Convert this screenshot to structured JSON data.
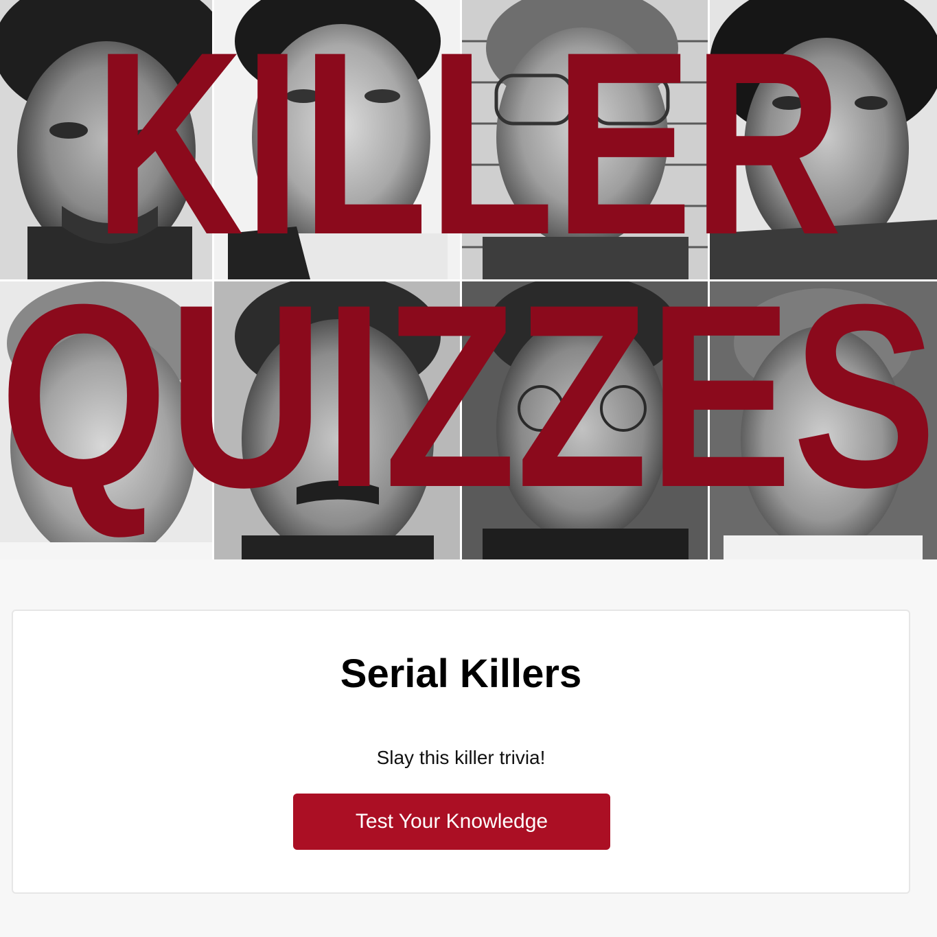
{
  "hero": {
    "title_line_1": "KILLER",
    "title_line_2": "QUIZZES",
    "title_color": "#8b0a1c",
    "photos": [
      {
        "name": "mugshot-photo"
      },
      {
        "name": "mugshot-photo"
      },
      {
        "name": "mugshot-photo"
      },
      {
        "name": "mugshot-photo"
      },
      {
        "name": "mugshot-photo"
      },
      {
        "name": "mugshot-photo"
      },
      {
        "name": "mugshot-photo"
      },
      {
        "name": "mugshot-photo"
      }
    ]
  },
  "quiz_card": {
    "title": "Serial Killers",
    "subtitle": "Slay this killer trivia!",
    "button_label": "Test Your Knowledge",
    "button_color": "#ab0f24"
  }
}
